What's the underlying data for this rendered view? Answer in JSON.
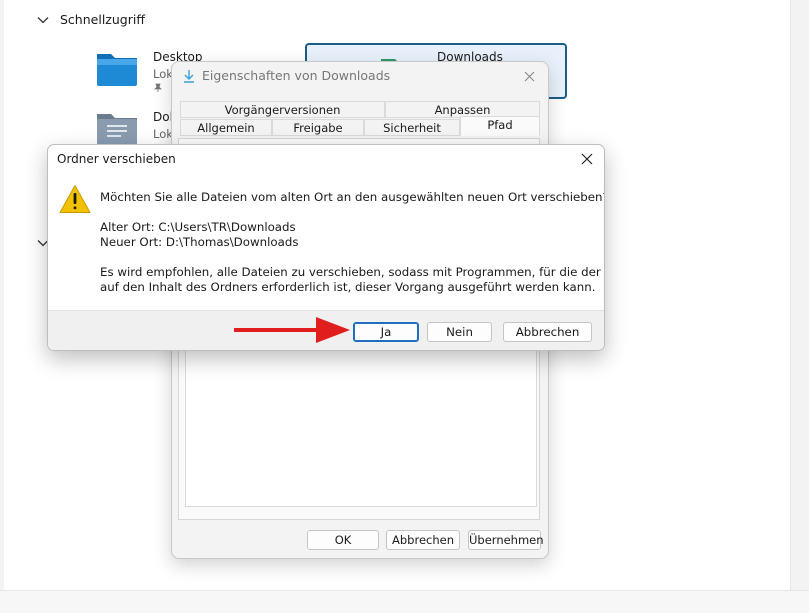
{
  "explorer": {
    "section_title": "Schnellzugriff",
    "items": [
      {
        "name": "Desktop",
        "sub": "Lok"
      },
      {
        "name": "Dol",
        "sub": "Lok"
      },
      {
        "name": "Downloads",
        "sub": ""
      }
    ]
  },
  "properties": {
    "title": "Eigenschaften von Downloads",
    "tabs_row1": [
      "Vorgängerversionen",
      "Anpassen"
    ],
    "tabs_row2": [
      "Allgemein",
      "Freigabe",
      "Sicherheit",
      "Pfad"
    ],
    "active_tab": "Pfad",
    "buttons": {
      "ok": "OK",
      "cancel": "Abbrechen",
      "apply": "Übernehmen"
    }
  },
  "move_dialog": {
    "title": "Ordner verschieben",
    "question": "Möchten Sie alle Dateien vom alten Ort an den ausgewählten neuen Ort verschieben?",
    "old_location": "Alter Ort: C:\\Users\\TR\\Downloads",
    "new_location": "Neuer Ort: D:\\Thomas\\Downloads",
    "recommendation_line1": "Es wird empfohlen, alle Dateien zu verschieben, sodass mit Programmen, für die der Zugriff",
    "recommendation_line2": "auf den Inhalt des Ordners erforderlich ist, dieser Vorgang ausgeführt werden kann.",
    "buttons": {
      "yes": "Ja",
      "no": "Nein",
      "cancel": "Abbrechen"
    }
  },
  "colors": {
    "accent": "#1f6fc0",
    "annotation_arrow": "#e01e1e",
    "warning": "#f2c200",
    "folder_blue": "#1e8ad6",
    "folder_green": "#2e9a6a"
  }
}
